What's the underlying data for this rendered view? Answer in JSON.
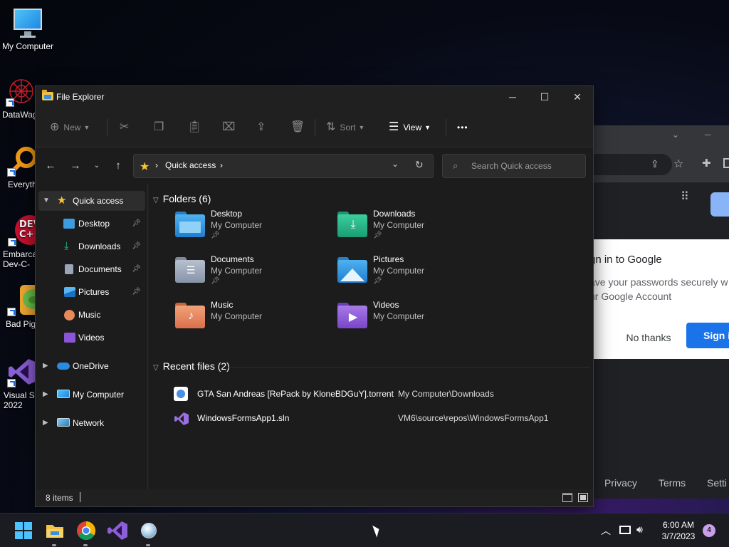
{
  "desktop": {
    "icons": [
      {
        "label": "My Computer",
        "icon": "monitor-icon"
      },
      {
        "label": "DataWag",
        "icon": "datawag-icon"
      },
      {
        "label": "Everyth",
        "icon": "everything-search-icon"
      },
      {
        "label": "Embarca\nDev-C-",
        "icon": "devcpp-icon"
      },
      {
        "label": "Bad Pig",
        "icon": "bad-piggies-icon"
      },
      {
        "label": "Visual St\n2022",
        "icon": "visual-studio-icon"
      }
    ]
  },
  "browser": {
    "popup_title": "gn in to Google",
    "popup_desc_line1": "ave your passwords securely w",
    "popup_desc_line2": "ur Google Account",
    "no_thanks": "No thanks",
    "sign_in": "Sign i",
    "footer": [
      "Privacy",
      "Terms",
      "Setti"
    ]
  },
  "explorer": {
    "title": "File Explorer",
    "window_buttons": {
      "minimize": "─",
      "maximize": "☐",
      "close": "✕"
    },
    "commands": {
      "new": "New",
      "sort": "Sort",
      "view": "View",
      "more": "•••"
    },
    "address": {
      "crumbs": [
        "Quick access"
      ]
    },
    "search": {
      "placeholder": "Search Quick access"
    },
    "sidebar": [
      {
        "label": "Quick access",
        "icon": "star-icon",
        "pinned": false,
        "selected": true,
        "expandable": true,
        "expanded": true
      },
      {
        "label": "Desktop",
        "icon": "desktop-folder-icon",
        "pinned": true
      },
      {
        "label": "Downloads",
        "icon": "download-icon",
        "pinned": true
      },
      {
        "label": "Documents",
        "icon": "documents-icon",
        "pinned": true
      },
      {
        "label": "Pictures",
        "icon": "pictures-icon",
        "pinned": true
      },
      {
        "label": "Music",
        "icon": "music-icon",
        "pinned": false
      },
      {
        "label": "Videos",
        "icon": "videos-icon",
        "pinned": false
      },
      {
        "label": "OneDrive",
        "icon": "cloud-icon",
        "pinned": false,
        "expandable": true
      },
      {
        "label": "My Computer",
        "icon": "monitor-icon",
        "pinned": false,
        "expandable": true
      },
      {
        "label": "Network",
        "icon": "network-icon",
        "pinned": false,
        "expandable": true
      }
    ],
    "folders_heading": "Folders (6)",
    "folders": [
      {
        "name": "Desktop",
        "location": "My Computer",
        "pinned": true,
        "color": "#3d9be0"
      },
      {
        "name": "Downloads",
        "location": "My Computer",
        "pinned": true,
        "color": "#2bb58a"
      },
      {
        "name": "Documents",
        "location": "My Computer",
        "pinned": true,
        "color": "#9aa6b8"
      },
      {
        "name": "Pictures",
        "location": "My Computer",
        "pinned": true,
        "color": "#3aa0e6"
      },
      {
        "name": "Music",
        "location": "My Computer",
        "pinned": false,
        "color": "#e7895a"
      },
      {
        "name": "Videos",
        "location": "My Computer",
        "pinned": false,
        "color": "#8a55d8"
      }
    ],
    "recent_heading": "Recent files (2)",
    "recent": [
      {
        "name": "GTA San Andreas [RePack by KloneBDGuY].torrent",
        "path": "My Computer\\Downloads",
        "icon": "torrent-file-icon"
      },
      {
        "name": "WindowsFormsApp1.sln",
        "path": "VM6\\source\\repos\\WindowsFormsApp1",
        "icon": "vs-solution-file-icon"
      }
    ],
    "status": {
      "count": "8 items"
    }
  },
  "taskbar": {
    "apps": [
      "start-icon",
      "file-explorer-icon",
      "chrome-icon",
      "visual-studio-icon",
      "app-icon"
    ],
    "clock_time": "6:00 AM",
    "clock_date": "3/7/2023",
    "notifications": "4"
  }
}
